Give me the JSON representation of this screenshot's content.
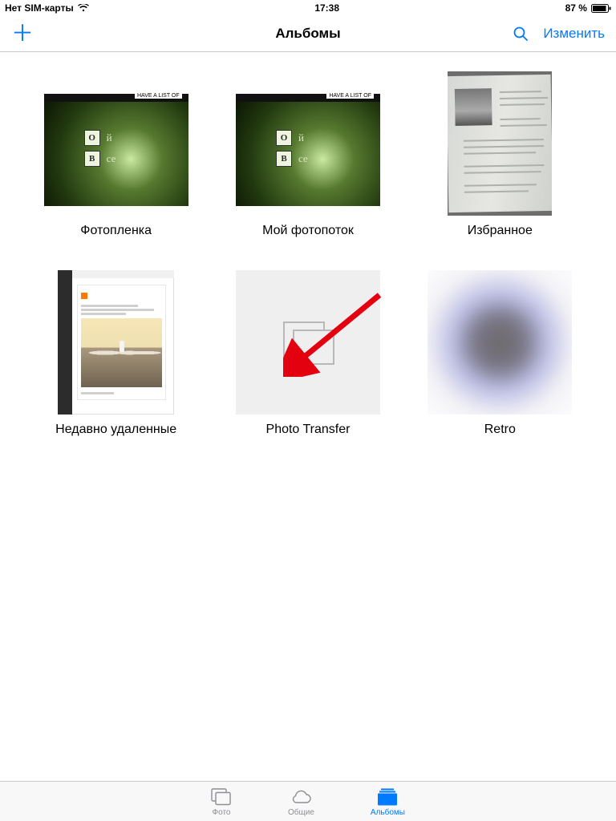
{
  "status": {
    "carrier": "Нет SIM-карты",
    "time": "17:38",
    "battery_pct": "87 %"
  },
  "nav": {
    "title": "Альбомы",
    "edit": "Изменить"
  },
  "albums": [
    {
      "title": "Фотопленка",
      "kind": "green"
    },
    {
      "title": "Мой фотопоток",
      "kind": "green"
    },
    {
      "title": "Избранное",
      "kind": "paper"
    },
    {
      "title": "Недавно удаленные",
      "kind": "screenshot"
    },
    {
      "title": "Photo Transfer",
      "kind": "empty"
    },
    {
      "title": "Retro",
      "kind": "blur"
    }
  ],
  "tabs": {
    "photos": "Фото",
    "shared": "Общие",
    "albums": "Альбомы"
  },
  "thumb_text": {
    "t1": "О",
    "t2": "й",
    "t3": "В",
    "t4": "се",
    "strip": "HAVE A LIST OF"
  }
}
